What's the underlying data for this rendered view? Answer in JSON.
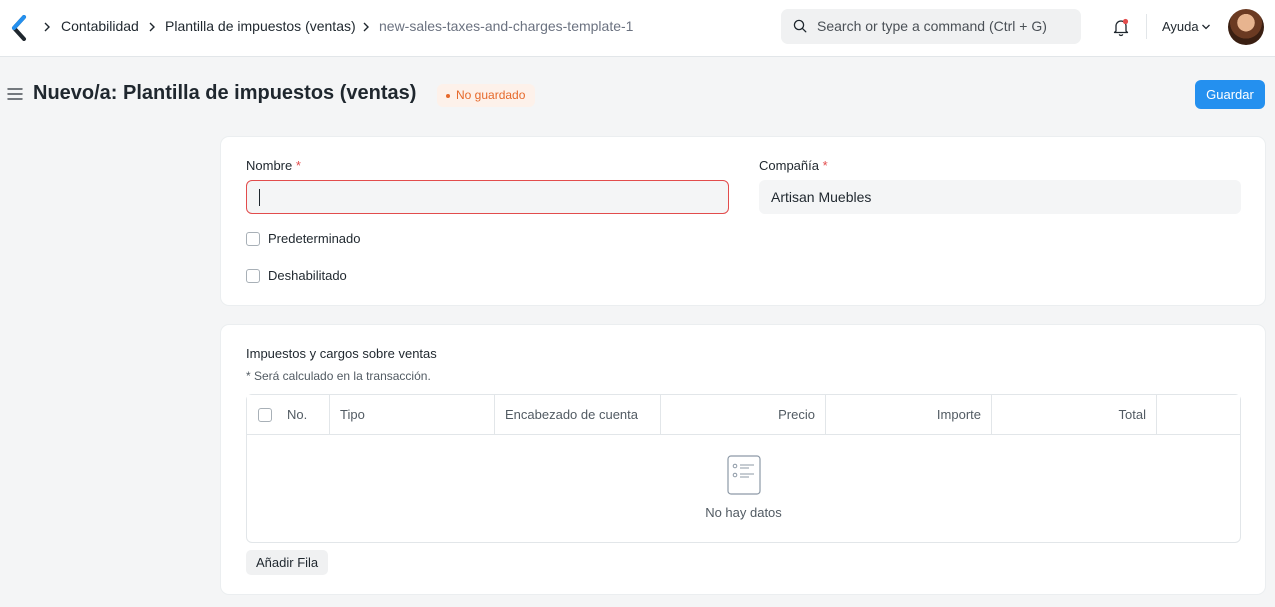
{
  "navbar": {
    "breadcrumbs": [
      "Contabilidad",
      "Plantilla de impuestos (ventas)",
      "new-sales-taxes-and-charges-template-1"
    ],
    "search_placeholder": "Search or type a command (Ctrl + G)",
    "help_label": "Ayuda"
  },
  "page": {
    "title": "Nuevo/a: Plantilla de impuestos (ventas)",
    "status_badge": "No guardado",
    "save_label": "Guardar"
  },
  "form": {
    "name_label": "Nombre",
    "name_value": "",
    "company_label": "Compañía",
    "company_value": "Artisan Muebles",
    "required_mark": "*",
    "default_label": "Predeterminado",
    "default_checked": false,
    "disabled_label": "Deshabilitado",
    "disabled_checked": false
  },
  "taxes_section": {
    "title": "Impuestos y cargos sobre ventas",
    "description": "* Será calculado en la transacción.",
    "columns": [
      "No.",
      "Tipo",
      "Encabezado de cuenta",
      "Precio",
      "Importe",
      "Total"
    ],
    "rows": [],
    "empty_text": "No hay datos",
    "add_row_label": "Añadir Fila"
  },
  "colors": {
    "primary": "#2490ef",
    "danger": "#e24c4c",
    "warning": "#e6692b"
  }
}
